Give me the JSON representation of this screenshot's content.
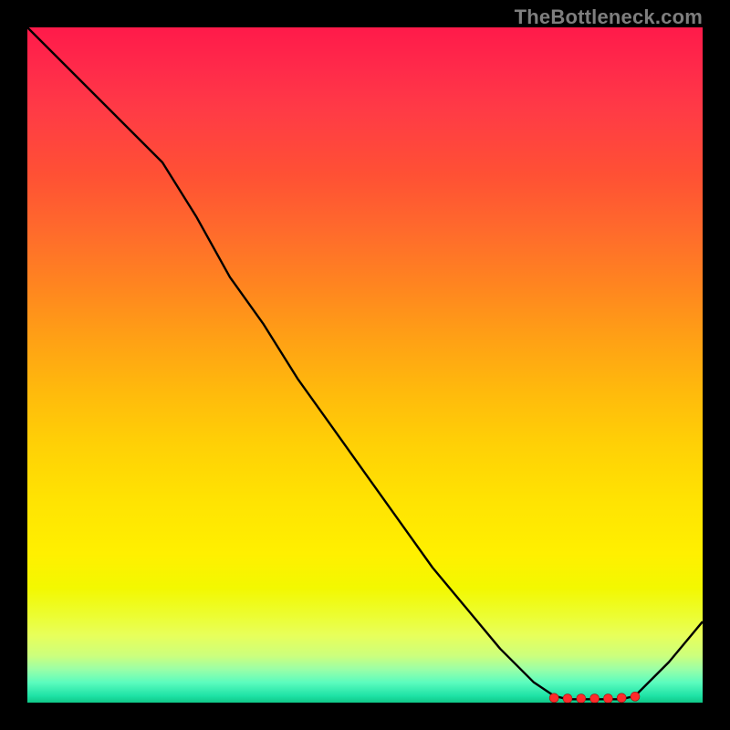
{
  "watermark": "TheBottleneck.com",
  "chart_data": {
    "type": "line",
    "title": "",
    "xlabel": "",
    "ylabel": "",
    "xlim": [
      0,
      100
    ],
    "ylim": [
      0,
      100
    ],
    "x": [
      0,
      5,
      10,
      15,
      20,
      25,
      30,
      35,
      40,
      45,
      50,
      55,
      60,
      65,
      70,
      75,
      78,
      80,
      82,
      84,
      86,
      88,
      90,
      95,
      100
    ],
    "values": [
      100,
      95,
      90,
      85,
      80,
      72,
      63,
      56,
      48,
      41,
      34,
      27,
      20,
      14,
      8,
      3,
      1,
      0.5,
      0.5,
      0.5,
      0.5,
      0.5,
      1,
      6,
      12
    ],
    "markers_x": [
      78,
      80,
      82,
      84,
      86,
      88,
      90
    ],
    "markers_y": [
      0.7,
      0.6,
      0.6,
      0.6,
      0.6,
      0.7,
      0.9
    ]
  }
}
